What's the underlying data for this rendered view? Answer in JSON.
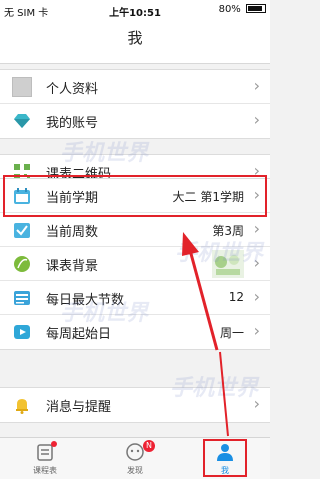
{
  "status": {
    "carrier": "无 SIM 卡",
    "time": "上午10:51",
    "battery": "80%"
  },
  "title": "我",
  "groups": [
    {
      "rows": [
        {
          "label": "个人资料",
          "icon": "avatar-icon"
        },
        {
          "label": "我的账号",
          "icon": "diamond-icon"
        }
      ]
    },
    {
      "rows": [
        {
          "label": "课表二维码",
          "icon": "qrcode-icon"
        }
      ]
    },
    {
      "rows": [
        {
          "label": "当前学期",
          "value": "大二 第1学期",
          "icon": "calendar-icon"
        },
        {
          "label": "当前周数",
          "value": "第3周",
          "icon": "checkbox-icon"
        },
        {
          "label": "课表背景",
          "icon": "leaf-icon"
        },
        {
          "label": "每日最大节数",
          "value": "12",
          "icon": "table-icon"
        },
        {
          "label": "每周起始日",
          "value": "周一",
          "icon": "play-icon"
        }
      ]
    },
    {
      "rows": [
        {
          "label": "消息与提醒",
          "icon": "bell-icon"
        }
      ]
    }
  ],
  "tabs": [
    {
      "label": "课程表",
      "icon": "schedule-icon"
    },
    {
      "label": "发现",
      "icon": "discover-icon",
      "badge": "N"
    },
    {
      "label": "我",
      "icon": "person-icon",
      "active": true
    }
  ],
  "watermark": "手机世界",
  "colors": {
    "accent": "#1a8fe3",
    "highlight": "#e2222a"
  }
}
